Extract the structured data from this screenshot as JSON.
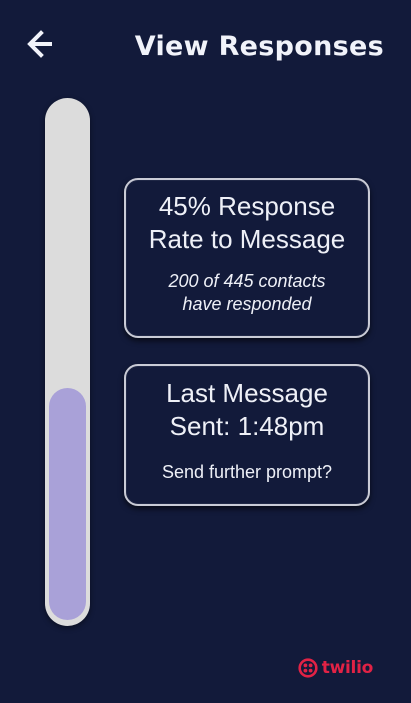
{
  "header": {
    "back_icon": "arrow-left-icon",
    "title": "View Responses"
  },
  "response_progress": {
    "fraction": 0.45,
    "fill_color": "#a9a1d8",
    "track_color": "#dcdcdc"
  },
  "rate_card": {
    "headline_line1": "45% Response",
    "headline_line2": "Rate to Message",
    "detail_line1": "200 of 445 contacts",
    "detail_line2": "have responded"
  },
  "last_message_card": {
    "headline_line1": "Last Message",
    "headline_line2": "Sent: 1:48pm",
    "prompt_label": "Send further prompt?"
  },
  "branding": {
    "logo_icon": "twilio-logo-icon",
    "logo_text": "twilio",
    "brand_color": "#e22245"
  },
  "colors": {
    "background": "#121a3a",
    "card_border": "#c9cbd6",
    "text": "#eef0f7"
  }
}
